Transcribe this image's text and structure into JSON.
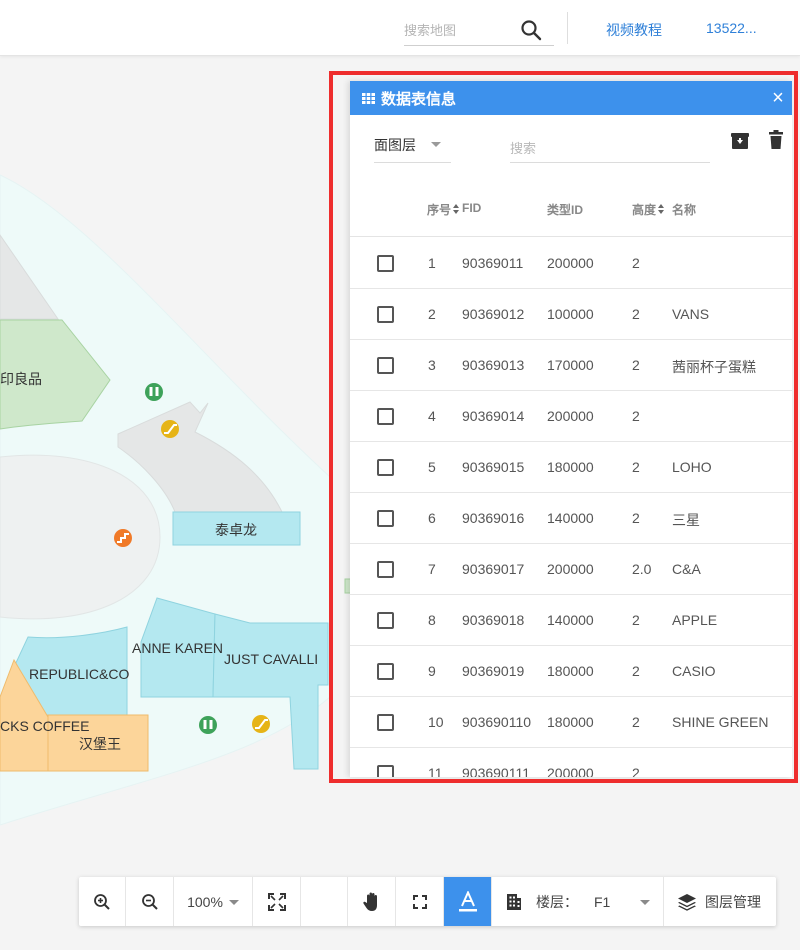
{
  "topbar": {
    "search_placeholder": "搜索地图",
    "search_icon": "search-icon",
    "tutorial_link": "视频教程",
    "user_account": "13522..."
  },
  "map": {
    "labels": {
      "muji": "印良品",
      "taizhuolong": "泰卓龙",
      "anne_karen": "ANNE KAREN",
      "just_cavalli": "JUST CAVALLI",
      "republic": "REPUBLIC&CO",
      "starbucks": "CKS COFFEE",
      "burger_king": "汉堡王"
    },
    "icons": [
      "restroom-icon",
      "escalator-icon",
      "restroom-icon",
      "escalator-icon",
      "stairs-icon"
    ],
    "colors": {
      "background": "#f4f4f4",
      "floor": "#eefaf9",
      "green_store": "#cfe8cb",
      "cyan_store": "#b4e8f0",
      "orange_store": "#fcd59a",
      "grey_store": "#e5e7e7"
    }
  },
  "panel": {
    "title": "数据表信息",
    "title_icon": "table-grid-icon",
    "close_icon": "close-icon",
    "layer_select_value": "面图层",
    "search_placeholder": "搜索",
    "archive_icon": "archive-download-icon",
    "delete_icon": "trash-icon",
    "header_color": "#3d91ec",
    "columns": {
      "seq": "序号",
      "fid": "FID",
      "type": "类型ID",
      "height": "高度",
      "name": "名称"
    },
    "rows": [
      {
        "seq": "1",
        "fid": "90369011",
        "type": "200000",
        "height": "2",
        "name": ""
      },
      {
        "seq": "2",
        "fid": "90369012",
        "type": "100000",
        "height": "2",
        "name": "VANS"
      },
      {
        "seq": "3",
        "fid": "90369013",
        "type": "170000",
        "height": "2",
        "name": "茜丽杯子蛋糕"
      },
      {
        "seq": "4",
        "fid": "90369014",
        "type": "200000",
        "height": "2",
        "name": ""
      },
      {
        "seq": "5",
        "fid": "90369015",
        "type": "180000",
        "height": "2",
        "name": "LOHO"
      },
      {
        "seq": "6",
        "fid": "90369016",
        "type": "140000",
        "height": "2",
        "name": "三星"
      },
      {
        "seq": "7",
        "fid": "90369017",
        "type": "200000",
        "height": "2.0",
        "name": "C&A"
      },
      {
        "seq": "8",
        "fid": "90369018",
        "type": "140000",
        "height": "2",
        "name": "APPLE"
      },
      {
        "seq": "9",
        "fid": "90369019",
        "type": "180000",
        "height": "2",
        "name": "CASIO"
      },
      {
        "seq": "10",
        "fid": "903690110",
        "type": "180000",
        "height": "2",
        "name": "SHINE GREEN"
      },
      {
        "seq": "11",
        "fid": "903690111",
        "type": "200000",
        "height": "2",
        "name": ""
      }
    ]
  },
  "toolbar": {
    "zoom_in_icon": "zoom-in-icon",
    "zoom_out_icon": "zoom-out-icon",
    "zoom_level": "100%",
    "fullscreen_icon": "fullscreen-icon",
    "pan_icon": "hand-pan-icon",
    "frame_icon": "frame-select-icon",
    "label_icon": "text-label-icon",
    "building_icon": "building-icon",
    "floor_label": "楼层：",
    "floor_value": "F1",
    "layers_icon": "layers-icon",
    "layer_manage": "图层管理",
    "active_color": "#3d91ec"
  }
}
